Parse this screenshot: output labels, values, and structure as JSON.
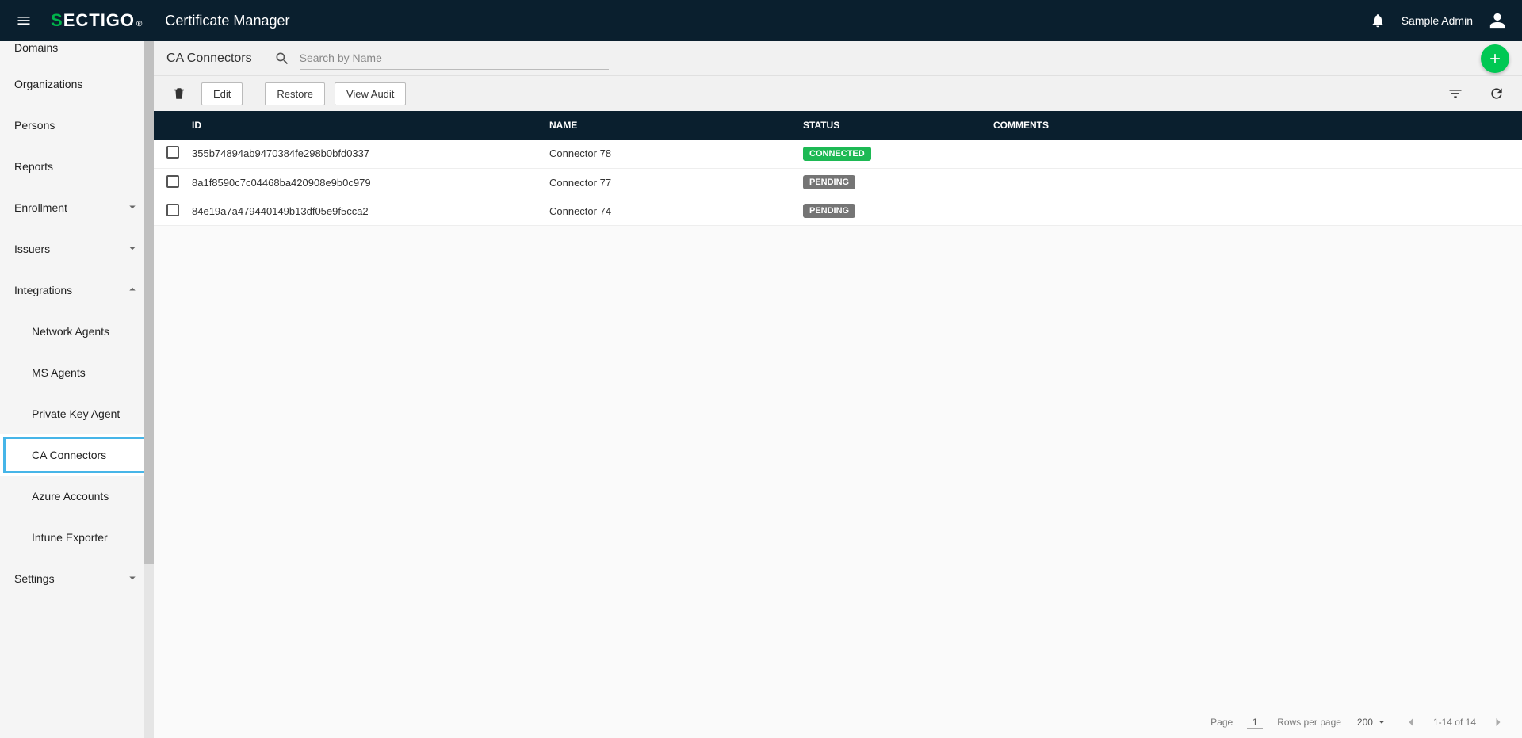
{
  "header": {
    "app_title": "Certificate Manager",
    "logo_brand_a": "S",
    "logo_brand_b": "ECTIGO",
    "logo_reg": "®",
    "username": "Sample Admin"
  },
  "sidebar": {
    "items": [
      {
        "label": "Domains",
        "expandable": false,
        "truncated_top": true
      },
      {
        "label": "Organizations",
        "expandable": false
      },
      {
        "label": "Persons",
        "expandable": false
      },
      {
        "label": "Reports",
        "expandable": false
      },
      {
        "label": "Enrollment",
        "expandable": true,
        "expanded": false
      },
      {
        "label": "Issuers",
        "expandable": true,
        "expanded": false
      },
      {
        "label": "Integrations",
        "expandable": true,
        "expanded": true,
        "children": [
          {
            "label": "Network Agents"
          },
          {
            "label": "MS Agents"
          },
          {
            "label": "Private Key Agent"
          },
          {
            "label": "CA Connectors",
            "active": true
          },
          {
            "label": "Azure Accounts"
          },
          {
            "label": "Intune Exporter"
          }
        ]
      },
      {
        "label": "Settings",
        "expandable": true,
        "expanded": false
      }
    ]
  },
  "toolbar": {
    "page_title": "CA Connectors",
    "search_placeholder": "Search by Name",
    "edit_label": "Edit",
    "restore_label": "Restore",
    "audit_label": "View Audit"
  },
  "table": {
    "columns": {
      "id": "ID",
      "name": "NAME",
      "status": "STATUS",
      "comments": "COMMENTS"
    },
    "rows": [
      {
        "id": "355b74894ab9470384fe298b0bfd0337",
        "name": "Connector 78",
        "status": "CONNECTED",
        "status_kind": "connected",
        "comments": ""
      },
      {
        "id": "8a1f8590c7c04468ba420908e9b0c979",
        "name": "Connector 77",
        "status": "PENDING",
        "status_kind": "pending",
        "comments": ""
      },
      {
        "id": "84e19a7a479440149b13df05e9f5cca2",
        "name": "Connector 74",
        "status": "PENDING",
        "status_kind": "pending",
        "comments": ""
      }
    ]
  },
  "pagination": {
    "page_label": "Page",
    "page_value": "1",
    "rpp_label": "Rows per page",
    "rpp_value": "200",
    "range_label": "1-14 of 14"
  },
  "colors": {
    "header_bg": "#0A1F2E",
    "accent_green": "#00C853",
    "status_connected": "#1db954",
    "status_pending": "#757575",
    "highlight": "#46b5e8"
  }
}
